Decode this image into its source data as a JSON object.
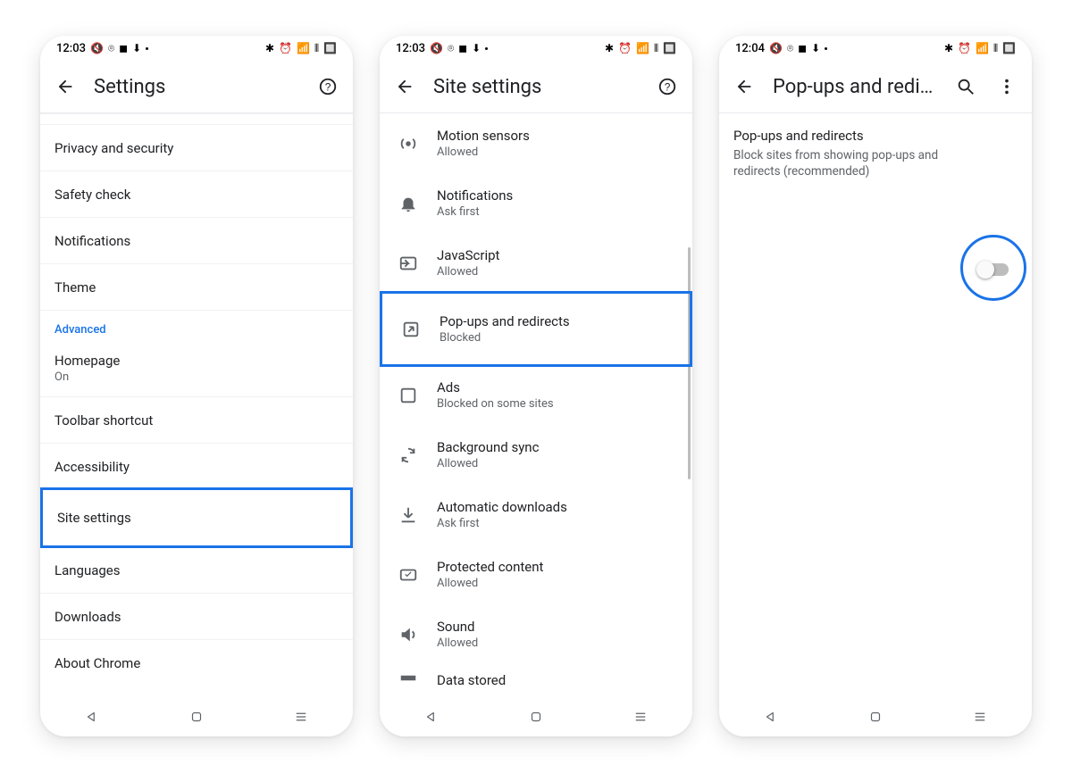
{
  "screen1": {
    "status": {
      "time": "12:03"
    },
    "title": "Settings",
    "items_top": [
      {
        "label": "Privacy and security"
      },
      {
        "label": "Safety check"
      },
      {
        "label": "Notifications"
      },
      {
        "label": "Theme"
      }
    ],
    "advanced_label": "Advanced",
    "homepage": {
      "label": "Homepage",
      "sub": "On"
    },
    "items_after": [
      {
        "label": "Toolbar shortcut"
      },
      {
        "label": "Accessibility"
      }
    ],
    "highlight": {
      "label": "Site settings"
    },
    "items_tail": [
      {
        "label": "Languages"
      },
      {
        "label": "Downloads"
      },
      {
        "label": "About Chrome"
      }
    ]
  },
  "screen2": {
    "status": {
      "time": "12:03"
    },
    "title": "Site settings",
    "items_before": [
      {
        "label": "Motion sensors",
        "sub": "Allowed",
        "icon": "sensor"
      },
      {
        "label": "Notifications",
        "sub": "Ask first",
        "icon": "bell"
      },
      {
        "label": "JavaScript",
        "sub": "Allowed",
        "icon": "script"
      }
    ],
    "highlight": {
      "label": "Pop-ups and redirects",
      "sub": "Blocked",
      "icon": "popup"
    },
    "items_after": [
      {
        "label": "Ads",
        "sub": "Blocked on some sites",
        "icon": "ads"
      },
      {
        "label": "Background sync",
        "sub": "Allowed",
        "icon": "sync"
      },
      {
        "label": "Automatic downloads",
        "sub": "Ask first",
        "icon": "download"
      },
      {
        "label": "Protected content",
        "sub": "Allowed",
        "icon": "protected"
      },
      {
        "label": "Sound",
        "sub": "Allowed",
        "icon": "sound"
      }
    ],
    "partial": {
      "label": "Data stored"
    }
  },
  "screen3": {
    "status": {
      "time": "12:04"
    },
    "title": "Pop-ups and redir...",
    "toggle": {
      "title": "Pop-ups and redirects",
      "desc": "Block sites from showing pop-ups and redirects (recommended)",
      "on": false
    }
  }
}
